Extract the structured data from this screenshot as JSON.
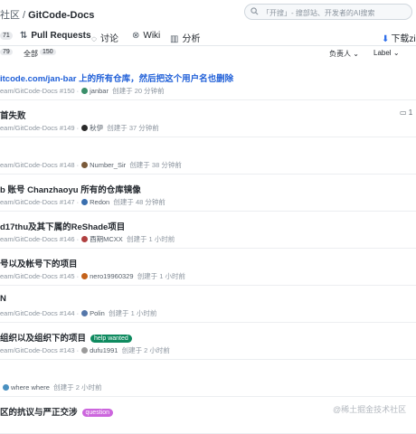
{
  "header": {
    "crumb_org": "社区",
    "crumb_sep": "/",
    "crumb_repo": "GitCode-Docs",
    "search_placeholder": "「开搜」- 搜部站、开发者的AI搜索"
  },
  "tabs": [
    {
      "count": "71",
      "label": "Pull Requests"
    },
    {
      "label": "讨论"
    },
    {
      "label": "Wiki"
    },
    {
      "label": "分析"
    }
  ],
  "download_label": "下载zip",
  "filters": {
    "count_left": "79",
    "all_label": "全部",
    "all_count": "150",
    "assignee_label": "负责人",
    "label_label": "Label"
  },
  "issues": [
    {
      "title": "itcode.com/jan-bar 上的所有仓库，然后把这个用户名也删除",
      "meta_prefix": "eam/GitCode-Docs #150 ·",
      "user": "janbar",
      "created": "创建于 20 分钟前",
      "comments": "",
      "link": true
    },
    {
      "title": "首失败",
      "meta_prefix": "eam/GitCode-Docs #149 ·",
      "user": "秋伊",
      "created": "创建于 37 分钟前",
      "comments": "1"
    },
    {
      "title": "",
      "meta_prefix": "eam/GitCode-Docs #148 ·",
      "user": "Number_Sir",
      "created": "创建于 38 分钟前",
      "comments": ""
    },
    {
      "title": "b 账号 Chanzhaoyu 所有的仓库镜像",
      "meta_prefix": "eam/GitCode-Docs #147 ·",
      "user": "Redon",
      "created": "创建于 48 分钟前",
      "comments": ""
    },
    {
      "title": "d17thu及其下属的ReShade项目",
      "meta_prefix": "eam/GitCode-Docs #146 ·",
      "user": "酉期MCXX",
      "created": "创建于 1 小时前",
      "comments": ""
    },
    {
      "title": "号以及帐号下的项目",
      "meta_prefix": "eam/GitCode-Docs #145 ·",
      "user": "nero19960329",
      "created": "创建于 1 小时前",
      "comments": ""
    },
    {
      "title": "N",
      "meta_prefix": "eam/GitCode-Docs #144 ·",
      "user": "Polin",
      "created": "创建于 1 小时前",
      "comments": ""
    },
    {
      "title": "组织以及组织下的项目",
      "label": "help wanted",
      "meta_prefix": "eam/GitCode-Docs #143 ·",
      "user": "dufu1991",
      "created": "创建于 2 小时前",
      "comments": ""
    },
    {
      "title": "",
      "meta_prefix": "",
      "user": "where where",
      "created": "创建于 2 小时前",
      "comments": ""
    },
    {
      "title": "区的抗议与严正交涉",
      "label": "question",
      "meta_prefix": "",
      "user": "",
      "created": "",
      "comments": ""
    }
  ],
  "colors": {
    "link": "#1f5fd8",
    "help_wanted": "#0e8a5f",
    "question": "#cc66dd",
    "accent": "#2f6fea"
  },
  "watermark": "@稀土掘金技术社区"
}
